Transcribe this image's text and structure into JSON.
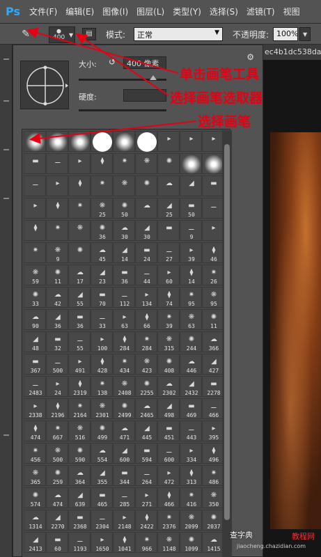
{
  "app": {
    "logo": "Ps"
  },
  "menu": [
    "文件(F)",
    "编辑(E)",
    "图像(I)",
    "图层(L)",
    "类型(Y)",
    "选择(S)",
    "滤镜(T)",
    "视图"
  ],
  "options": {
    "brush_size": "400",
    "mode_label": "模式:",
    "mode_value": "正常",
    "opacity_label": "不透明度:",
    "opacity_value": "100%"
  },
  "document": {
    "tab_title": "ec4b1dc538da"
  },
  "picker": {
    "size_label": "大小:",
    "size_value": "400 像素",
    "hardness_label": "硬度:"
  },
  "annotations": {
    "click_brush_tool": "单击画笔工具",
    "select_brush_picker": "选择画笔选取器",
    "select_brush": "选择画笔"
  },
  "brush_rows": [
    [
      "",
      "",
      "",
      "",
      "",
      "",
      "",
      "",
      ""
    ],
    [
      "",
      "",
      "",
      "",
      "",
      "",
      "",
      "",
      ""
    ],
    [
      "",
      "",
      "",
      "",
      "",
      "",
      "",
      "",
      ""
    ],
    [
      "",
      "",
      "",
      "25",
      "50",
      "",
      "25",
      "50",
      ""
    ],
    [
      "",
      "",
      "",
      "36",
      "30",
      "30",
      "",
      "9",
      ""
    ],
    [
      "",
      "9",
      "",
      "45",
      "14",
      "24",
      "27",
      "39",
      "46"
    ],
    [
      "59",
      "11",
      "17",
      "23",
      "36",
      "44",
      "60",
      "14",
      "26"
    ],
    [
      "33",
      "42",
      "55",
      "70",
      "112",
      "134",
      "74",
      "95",
      "95"
    ],
    [
      "90",
      "36",
      "36",
      "33",
      "63",
      "66",
      "39",
      "63",
      "11"
    ],
    [
      "48",
      "32",
      "55",
      "100",
      "284",
      "284",
      "315",
      "244",
      "366"
    ],
    [
      "367",
      "500",
      "491",
      "428",
      "434",
      "423",
      "408",
      "446",
      "427"
    ],
    [
      "2483",
      "24",
      "2319",
      "138",
      "2408",
      "2255",
      "2302",
      "2432",
      "2278"
    ],
    [
      "2338",
      "2196",
      "2164",
      "2301",
      "2499",
      "2465",
      "498",
      "469",
      "466"
    ],
    [
      "474",
      "667",
      "516",
      "499",
      "471",
      "445",
      "451",
      "443",
      "395"
    ],
    [
      "456",
      "500",
      "590",
      "554",
      "600",
      "594",
      "600",
      "334",
      "496"
    ],
    [
      "365",
      "259",
      "364",
      "355",
      "344",
      "264",
      "472",
      "313",
      "486"
    ],
    [
      "574",
      "474",
      "639",
      "465",
      "285",
      "271",
      "466",
      "416",
      "350"
    ],
    [
      "1314",
      "2270",
      "2368",
      "2304",
      "2148",
      "2422",
      "2376",
      "2099",
      "2037"
    ],
    [
      "2413",
      "60",
      "1193",
      "1650",
      "1041",
      "966",
      "1148",
      "1099",
      "1415"
    ]
  ],
  "watermark": {
    "site": "查字典",
    "site2": "教程网",
    "domain": "jiaocheng.chazidian.com"
  },
  "colors": {
    "annotation": "#e60012",
    "ps_blue": "#31a8ff"
  }
}
